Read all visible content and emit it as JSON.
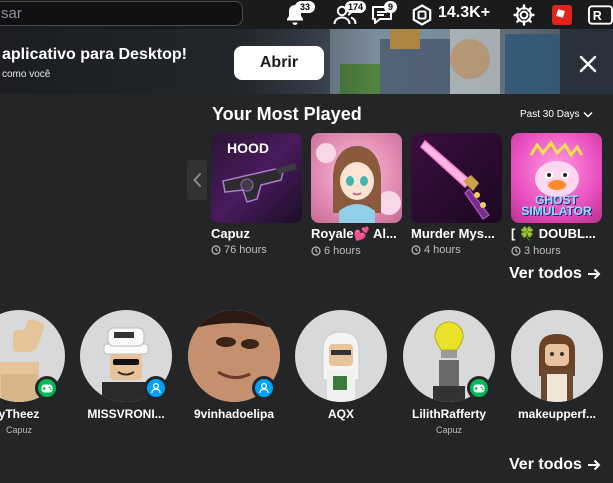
{
  "topbar": {
    "search_placeholder": "sar",
    "notifications_count": "33",
    "friends_count": "174",
    "messages_count": "9",
    "robux_amount": "14.3K+"
  },
  "banner": {
    "title": "aplicativo para Desktop!",
    "subtitle": "como você",
    "open_label": "Abrir"
  },
  "most_played": {
    "title": "Your Most Played",
    "period": "Past 30 Days",
    "see_all": "Ver todos",
    "games": [
      {
        "name": "Capuz",
        "hours": "76 hours",
        "thumb_text": "HOOD"
      },
      {
        "name": "Royale💕 Al...",
        "hours": "6 hours"
      },
      {
        "name": "Murder Mys...",
        "hours": "4 hours"
      },
      {
        "name": "[ 🍀 DOUBL...",
        "hours": "3 hours",
        "thumb_text": "GHOST SIMULATOR"
      }
    ]
  },
  "friends": {
    "see_all": "Ver todos",
    "items": [
      {
        "name": "yTheez",
        "game": "Capuz",
        "status": "in-game"
      },
      {
        "name": "MISSVRONI...",
        "game": "",
        "status": "online"
      },
      {
        "name": "9vinhadoelipa",
        "game": "",
        "status": "online"
      },
      {
        "name": "AQX",
        "game": "",
        "status": "none"
      },
      {
        "name": "LilithRafferty",
        "game": "Capuz",
        "status": "in-game"
      },
      {
        "name": "makeupperf...",
        "game": "",
        "status": "none"
      }
    ]
  },
  "colors": {
    "background": "#232527",
    "topbar": "#191b1d",
    "in_game_green": "#02b757",
    "online_blue": "#00a2ff",
    "roblox_red": "#e2231a"
  }
}
